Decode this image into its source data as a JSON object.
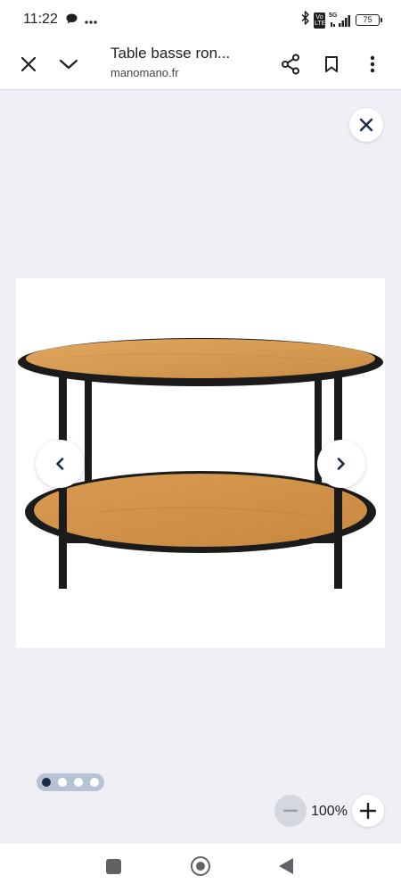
{
  "status_bar": {
    "time": "11:22",
    "volte_badge": "Vo LTE",
    "network": "5G",
    "battery": "75"
  },
  "toolbar": {
    "page_title": "Table basse ron...",
    "page_url": "manomano.fr",
    "icons": [
      "close-icon",
      "chevron-down-icon",
      "share-icon",
      "bookmark-icon",
      "more-vert-icon"
    ]
  },
  "viewer": {
    "image_alt": "Table basse ronde",
    "image_count": 4,
    "active_index": 0,
    "zoom_level": "100%"
  },
  "colors": {
    "viewer_bg": "#eef0f5",
    "dot_active": "#1b2a4e",
    "dot_track": "#b9c2d4",
    "wood": "#d39a52",
    "metal": "#1b1b1b"
  }
}
